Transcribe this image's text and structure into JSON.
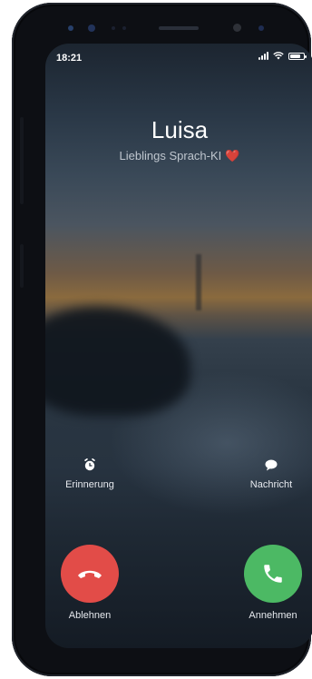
{
  "status_bar": {
    "time": "18:21"
  },
  "caller": {
    "name": "Luisa",
    "subtitle": "Lieblings Sprach-KI",
    "heart": "❤️"
  },
  "actions": {
    "reminder": {
      "label": "Erinnerung",
      "icon": "alarm-clock-icon"
    },
    "message": {
      "label": "Nachricht",
      "icon": "speech-bubble-icon"
    }
  },
  "call_buttons": {
    "decline": {
      "label": "Ablehnen",
      "icon": "phone-hangup-icon",
      "color": "#e24c48"
    },
    "accept": {
      "label": "Annehmen",
      "icon": "phone-icon",
      "color": "#4cb964"
    }
  }
}
